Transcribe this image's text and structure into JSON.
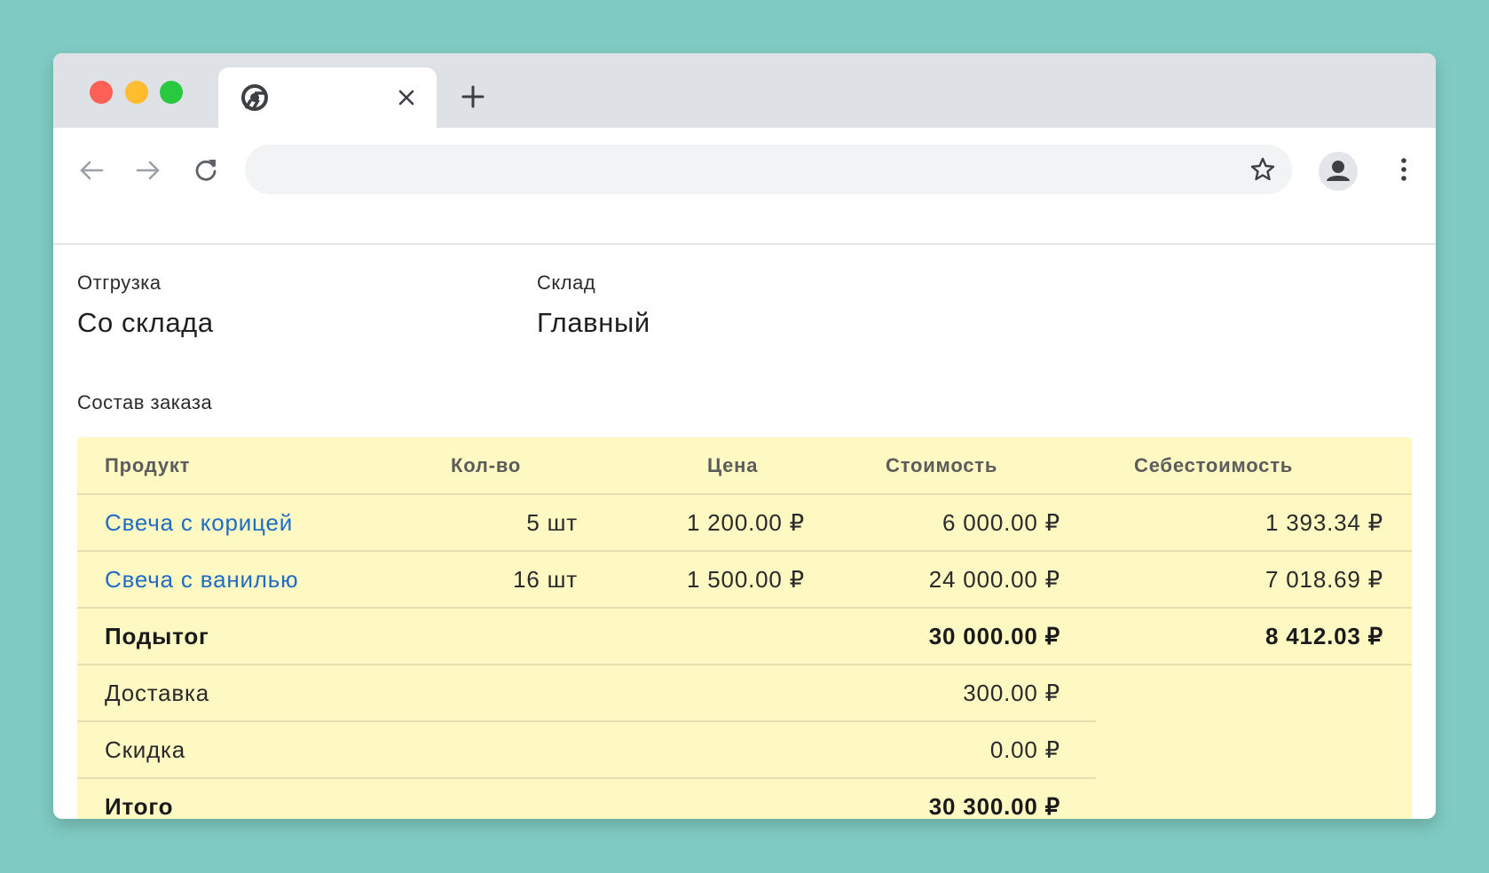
{
  "browser": {
    "tab_title": "",
    "url": ""
  },
  "form": {
    "shipment_label": "Отгрузка",
    "shipment_value": "Со склада",
    "warehouse_label": "Склад",
    "warehouse_value": "Главный",
    "section_title": "Состав заказа"
  },
  "table": {
    "headers": {
      "product": "Продукт",
      "qty": "Кол-во",
      "price": "Цена",
      "amount": "Стоимость",
      "cost": "Себестоимость"
    },
    "items": [
      {
        "product": "Свеча с корицей",
        "qty": "5 шт",
        "price": "1 200.00 ₽",
        "amount": "6 000.00 ₽",
        "cost": "1 393.34 ₽"
      },
      {
        "product": "Свеча с ванилью",
        "qty": "16 шт",
        "price": "1 500.00 ₽",
        "amount": "24 000.00 ₽",
        "cost": "7 018.69 ₽"
      }
    ],
    "subtotal": {
      "label": "Подытог",
      "amount": "30 000.00 ₽",
      "cost": "8 412.03 ₽"
    },
    "delivery": {
      "label": "Доставка",
      "amount": "300.00 ₽"
    },
    "discount": {
      "label": "Скидка",
      "amount": "0.00 ₽"
    },
    "total": {
      "label": "Итого",
      "amount": "30 300.00 ₽"
    }
  },
  "colors": {
    "background": "#7fcbc3",
    "table_background": "#fef9c3",
    "link": "#1f6cc4"
  }
}
